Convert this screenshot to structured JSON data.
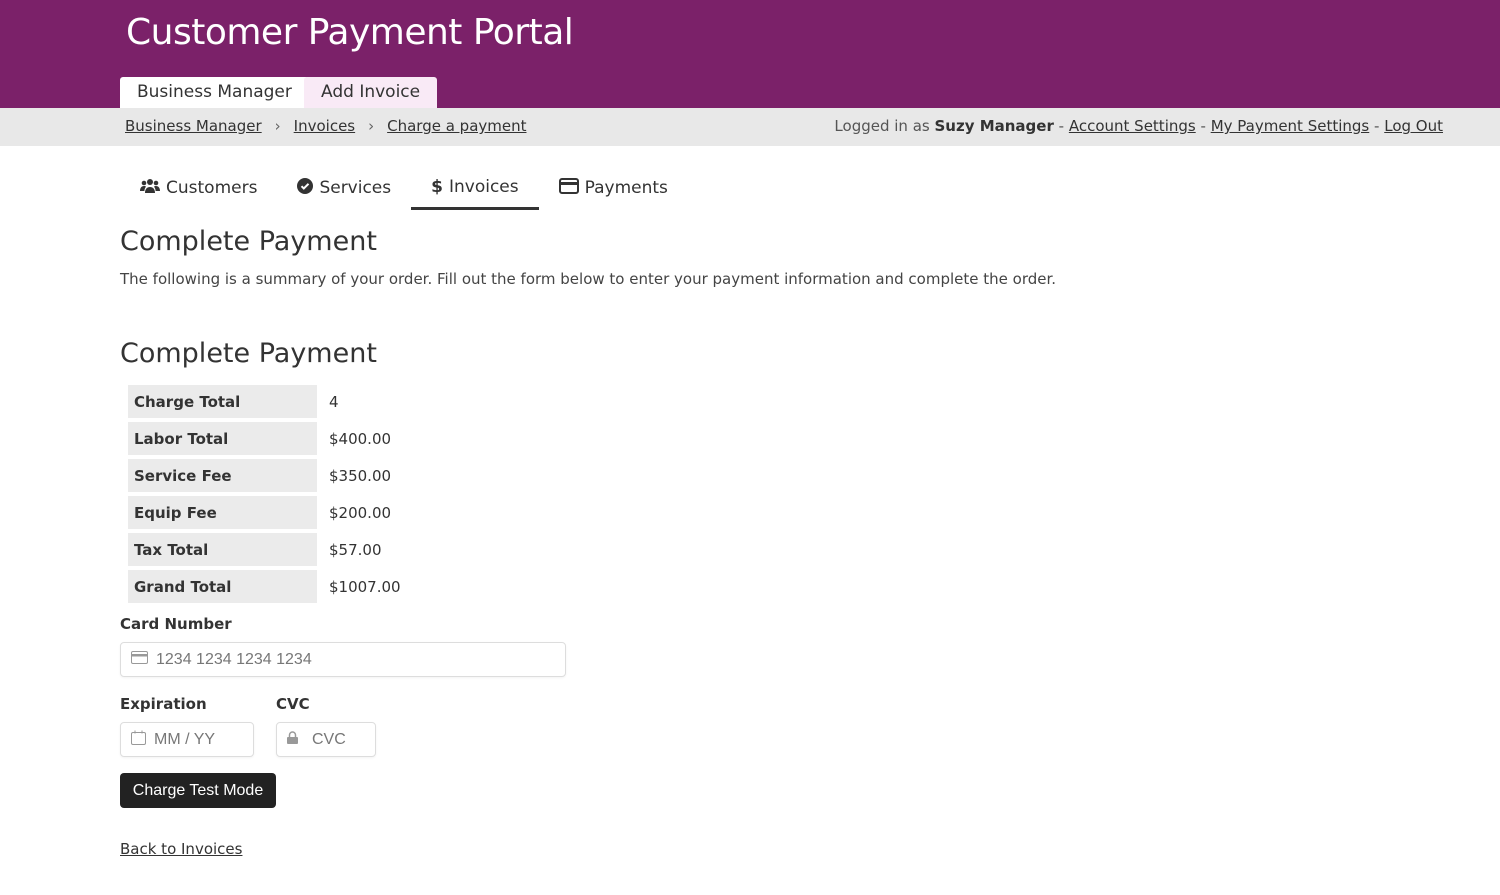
{
  "header": {
    "title": "Customer Payment Portal",
    "tabs": [
      "Business Manager",
      "Add Invoice"
    ]
  },
  "breadcrumb": [
    "Business Manager",
    "Invoices",
    "Charge a payment"
  ],
  "user": {
    "prefix": "Logged in as",
    "name": "Suzy Manager",
    "links": [
      "Account Settings",
      "My Payment Settings",
      "Log Out"
    ],
    "sep": "-"
  },
  "nav": [
    {
      "label": "Customers",
      "icon": "users-icon"
    },
    {
      "label": "Services",
      "icon": "check-circle-icon"
    },
    {
      "label": "Invoices",
      "icon": "dollar-icon"
    },
    {
      "label": "Payments",
      "icon": "credit-card-icon"
    }
  ],
  "page": {
    "title": "Complete Payment",
    "description": "The following is a summary of your order. Fill out the form below to enter your payment information and complete the order.",
    "section_title": "Complete Payment"
  },
  "summary": [
    {
      "label": "Charge Total",
      "value": "4"
    },
    {
      "label": "Labor Total",
      "value": "$400.00"
    },
    {
      "label": "Service Fee",
      "value": "$350.00"
    },
    {
      "label": "Equip Fee",
      "value": "$200.00"
    },
    {
      "label": "Tax Total",
      "value": "$57.00"
    },
    {
      "label": "Grand Total",
      "value": "$1007.00"
    }
  ],
  "form": {
    "card_label": "Card Number",
    "card_placeholder": "1234 1234 1234 1234",
    "exp_label": "Expiration",
    "exp_placeholder": "MM / YY",
    "cvc_label": "CVC",
    "cvc_placeholder": "CVC",
    "submit": "Charge Test Mode"
  },
  "back_link": "Back to Invoices"
}
